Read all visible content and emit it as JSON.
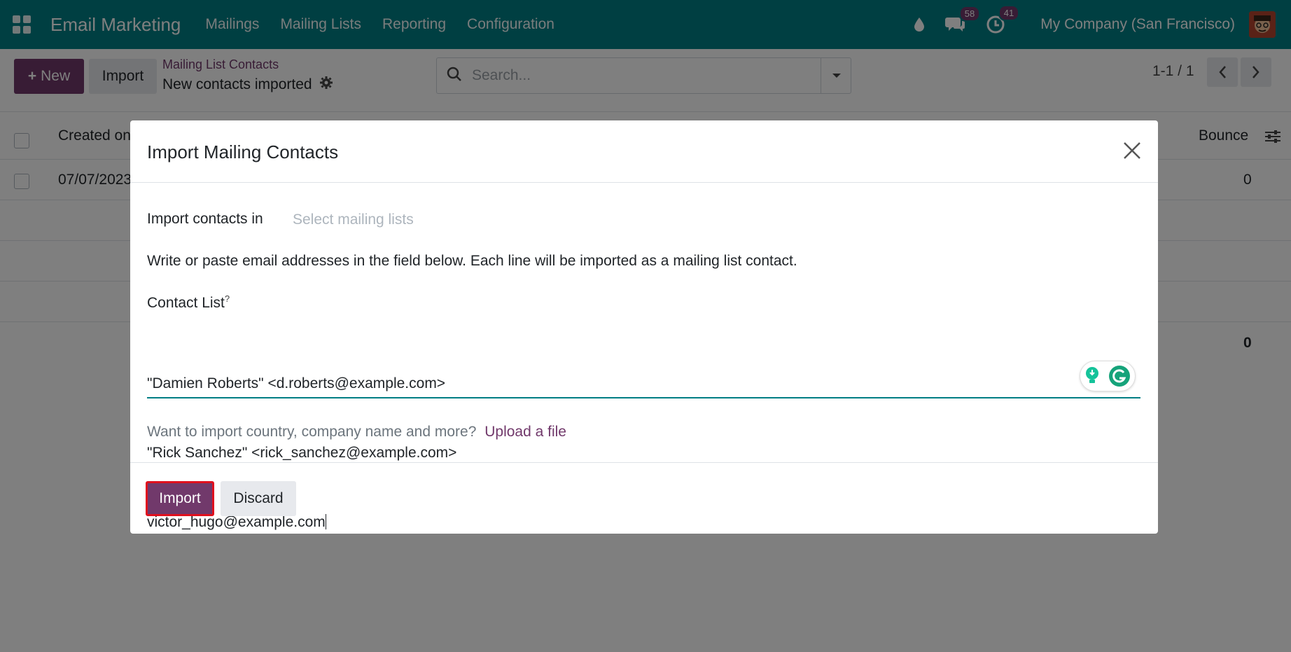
{
  "navbar": {
    "app_name": "Email Marketing",
    "menu": [
      "Mailings",
      "Mailing Lists",
      "Reporting",
      "Configuration"
    ],
    "messages_badge": "58",
    "activities_badge": "41",
    "company": "My Company (San Francisco)"
  },
  "control_panel": {
    "new_label": "New",
    "import_label": "Import",
    "breadcrumb": "Mailing List Contacts",
    "current": "New contacts imported",
    "search_placeholder": "Search...",
    "pager": "1-1 / 1"
  },
  "list": {
    "col_created": "Created on",
    "col_bounce": "Bounce",
    "row_date": "07/07/2023",
    "row_bounce": "0",
    "total_bounce": "0"
  },
  "modal": {
    "title": "Import Mailing Contacts",
    "import_in_label": "Import contacts in",
    "select_placeholder": "Select mailing lists",
    "help_text": "Write or paste email addresses in the field below. Each line will be imported as a mailing list contact.",
    "contact_list_label": "Contact List",
    "contact_list_help": "?",
    "contacts": [
      "\"Damien Roberts\" <d.roberts@example.com>",
      "\"Rick Sanchez\" <rick_sanchez@example.com>",
      "victor_hugo@example.com"
    ],
    "upload_prompt": "Want to import country, company name and more?",
    "upload_link": "Upload a file",
    "import_button": "Import",
    "discard_button": "Discard"
  },
  "colors": {
    "navbar": "#017e84",
    "primary": "#71396b"
  }
}
